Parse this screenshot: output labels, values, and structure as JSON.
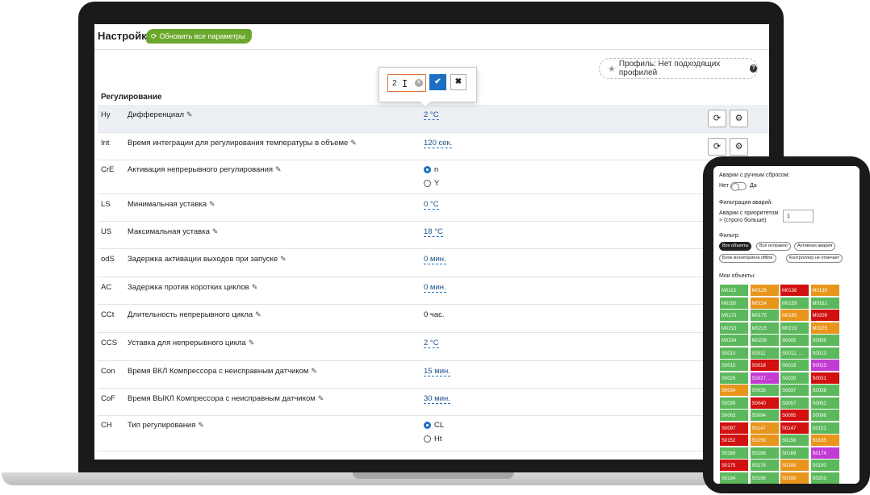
{
  "colors": {
    "accent_green": "#6aa82d",
    "accent_blue": "#1a6fc4",
    "status_ok": "#5cb85c",
    "status_alarm": "#d11010",
    "status_warning": "#e8951c",
    "status_offline": "#c23bd3"
  },
  "header": {
    "title": "Настройки",
    "refresh_all_label": "Обновить все параметры",
    "refresh_icon": "refresh-icon"
  },
  "profile": {
    "label": "Профиль: Нет подходящих профилей",
    "icons": [
      "star-icon",
      "help-icon"
    ]
  },
  "section_title": "Регулирование",
  "popover": {
    "input_value": "2",
    "confirm_icon": "check-icon",
    "cancel_icon": "close-icon"
  },
  "rows": [
    {
      "code": "Hy",
      "label": "Дифференциал",
      "value": "2 °C",
      "editable": true
    },
    {
      "code": "Int",
      "label": "Время интеграции для регулирования температуры в объеме",
      "value": "120 сек.",
      "editable": true
    },
    {
      "code": "CrE",
      "label": "Активация непрерывного регулирования",
      "options": [
        "n",
        "Y"
      ],
      "selected": "n"
    },
    {
      "code": "LS",
      "label": "Минимальная уставка",
      "value": "0 °C",
      "editable": true
    },
    {
      "code": "US",
      "label": "Максимальная уставка",
      "value": "18 °C",
      "editable": true
    },
    {
      "code": "odS",
      "label": "Задержка активации выходов при запуске",
      "value": "0 мин.",
      "editable": true
    },
    {
      "code": "AC",
      "label": "Задержка против коротких циклов",
      "value": "0 мин.",
      "editable": true
    },
    {
      "code": "CCt",
      "label": "Длительность непрерывного цикла",
      "value": "0 час.",
      "editable": false
    },
    {
      "code": "CCS",
      "label": "Уставка для непрерывного цикла",
      "value": "2 °C",
      "editable": true
    },
    {
      "code": "Con",
      "label": "Время ВКЛ Компрессора с неисправным датчиком",
      "value": "15 мин.",
      "editable": true
    },
    {
      "code": "CoF",
      "label": "Время ВЫКЛ Компрессора с неисправным датчиком",
      "value": "30 мин.",
      "editable": true
    },
    {
      "code": "CH",
      "label": "Тип регулирования",
      "options": [
        "CL",
        "Ht"
      ],
      "selected": "CL"
    }
  ],
  "phone": {
    "manual_reset_label": "Аварии с ручным сбросом:",
    "toggle_off": "Нет",
    "toggle_on": "Да",
    "alarm_filter_label": "Фильтрация аварий:",
    "priority_label_1": "Аварии с приоритетом",
    "priority_label_2": "> (строго больше)",
    "priority_value": "1",
    "filter_label": "Фильтр:",
    "chips": [
      "Все объекты",
      "Всё исправно",
      "Активная авария",
      "Блок мониторинга offline",
      "Контроллер не отвечает"
    ],
    "my_objects_label": "Мои объекты:",
    "objects": [
      {
        "id": "M0115",
        "status": "ok"
      },
      {
        "id": "M0126",
        "status": "warning"
      },
      {
        "id": "M0136",
        "status": "alarm"
      },
      {
        "id": "M0139",
        "status": "warning"
      },
      {
        "id": "M0150",
        "status": "ok"
      },
      {
        "id": "M0154",
        "status": "warning"
      },
      {
        "id": "M0159",
        "status": "ok"
      },
      {
        "id": "M0162",
        "status": "ok"
      },
      {
        "id": "M0173",
        "status": "ok"
      },
      {
        "id": "M0175",
        "status": "ok"
      },
      {
        "id": "M0185",
        "status": "warning"
      },
      {
        "id": "M0209",
        "status": "alarm"
      },
      {
        "id": "M0213",
        "status": "ok"
      },
      {
        "id": "M0215",
        "status": "ok"
      },
      {
        "id": "M0219",
        "status": "ok"
      },
      {
        "id": "M0225",
        "status": "warning"
      },
      {
        "id": "M0234",
        "status": "ok"
      },
      {
        "id": "M0239",
        "status": "ok"
      },
      {
        "id": "S0005",
        "status": "ok"
      },
      {
        "id": "S0006",
        "status": "ok"
      },
      {
        "id": "S0010",
        "status": "ok"
      },
      {
        "id": "S0011",
        "status": "ok"
      },
      {
        "id": "S0012, ...",
        "status": "ok"
      },
      {
        "id": "S0013",
        "status": "ok"
      },
      {
        "id": "S0015",
        "status": "ok"
      },
      {
        "id": "S0018",
        "status": "alarm"
      },
      {
        "id": "S0019",
        "status": "ok"
      },
      {
        "id": "S0023",
        "status": "offline"
      },
      {
        "id": "S0026",
        "status": "ok"
      },
      {
        "id": "S0027, ...",
        "status": "offline"
      },
      {
        "id": "S0030",
        "status": "ok"
      },
      {
        "id": "S0031",
        "status": "alarm"
      },
      {
        "id": "S0034",
        "status": "warning"
      },
      {
        "id": "S0035",
        "status": "ok"
      },
      {
        "id": "S0037",
        "status": "ok"
      },
      {
        "id": "S0038",
        "status": "ok"
      },
      {
        "id": "S0039",
        "status": "ok"
      },
      {
        "id": "S0040",
        "status": "alarm"
      },
      {
        "id": "S0057",
        "status": "ok"
      },
      {
        "id": "S0062",
        "status": "ok"
      },
      {
        "id": "S0063",
        "status": "ok"
      },
      {
        "id": "S0094",
        "status": "ok"
      },
      {
        "id": "S0095",
        "status": "alarm"
      },
      {
        "id": "S0096",
        "status": "ok"
      },
      {
        "id": "S0097",
        "status": "alarm"
      },
      {
        "id": "S0147",
        "status": "warning"
      },
      {
        "id": "S0147",
        "status": "alarm"
      },
      {
        "id": "S0151",
        "status": "ok"
      },
      {
        "id": "S0152",
        "status": "alarm"
      },
      {
        "id": "S0156",
        "status": "warning"
      },
      {
        "id": "S0158",
        "status": "ok"
      },
      {
        "id": "S0165",
        "status": "warning"
      },
      {
        "id": "S0166",
        "status": "ok"
      },
      {
        "id": "S0168",
        "status": "ok"
      },
      {
        "id": "S0169",
        "status": "ok"
      },
      {
        "id": "S0174",
        "status": "offline"
      },
      {
        "id": "S0175",
        "status": "alarm"
      },
      {
        "id": "S0176",
        "status": "ok"
      },
      {
        "id": "S0188",
        "status": "warning"
      },
      {
        "id": "S0190",
        "status": "ok"
      },
      {
        "id": "S0194",
        "status": "ok"
      },
      {
        "id": "S0196",
        "status": "ok"
      },
      {
        "id": "S0199",
        "status": "warning"
      },
      {
        "id": "S0203",
        "status": "ok"
      }
    ]
  }
}
